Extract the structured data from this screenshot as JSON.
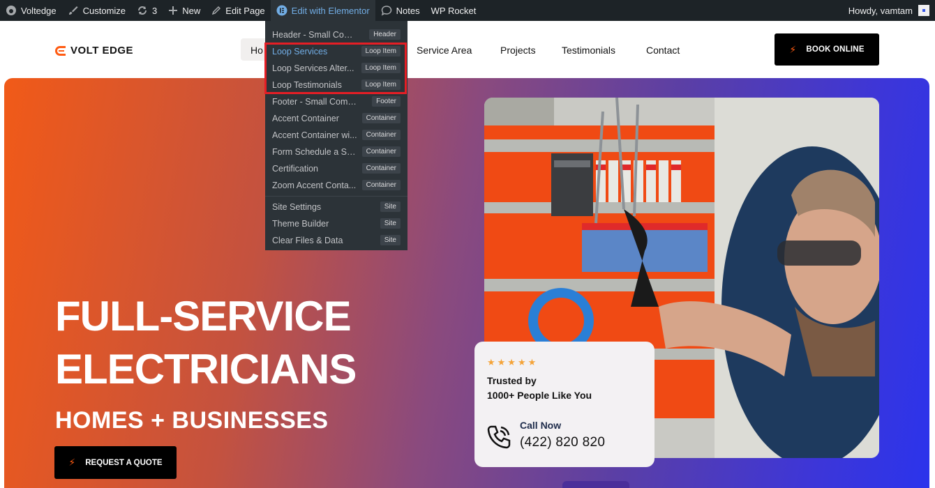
{
  "admin_bar": {
    "site_name": "Voltedge",
    "customize": "Customize",
    "updates_count": "3",
    "new": "New",
    "edit_page": "Edit Page",
    "edit_with_elementor": "Edit with Elementor",
    "notes": "Notes",
    "wp_rocket": "WP Rocket",
    "howdy": "Howdy, vamtam"
  },
  "elementor_menu": {
    "items": [
      {
        "label": "Header - Small Comp...",
        "badge": "Header"
      },
      {
        "label": "Loop Services",
        "badge": "Loop Item"
      },
      {
        "label": "Loop Services Alter...",
        "badge": "Loop Item"
      },
      {
        "label": "Loop Testimonials",
        "badge": "Loop Item"
      },
      {
        "label": "Footer - Small Company",
        "badge": "Footer"
      },
      {
        "label": "Accent Container",
        "badge": "Container"
      },
      {
        "label": "Accent Container wi...",
        "badge": "Container"
      },
      {
        "label": "Form Schedule a Se...",
        "badge": "Container"
      },
      {
        "label": "Certification",
        "badge": "Container"
      },
      {
        "label": "Zoom Accent Conta...",
        "badge": "Container"
      }
    ],
    "site_items": [
      {
        "label": "Site Settings",
        "badge": "Site"
      },
      {
        "label": "Theme Builder",
        "badge": "Site"
      },
      {
        "label": "Clear Files & Data",
        "badge": "Site"
      }
    ]
  },
  "header": {
    "logo_text": "VOLT EDGE",
    "nav_home_partial": "Ho",
    "nav": [
      "Service Area",
      "Projects",
      "Testimonials",
      "Contact"
    ],
    "book_button": "BOOK ONLINE"
  },
  "hero": {
    "title_line1": "FULL-SERVICE",
    "title_line2": "ELECTRICIANS",
    "subtitle": "HOMES + BUSINESSES",
    "quote_button": "REQUEST A QUOTE"
  },
  "trust_card": {
    "rating_stars": 5,
    "stars": "★★★★★",
    "line1": "Trusted by",
    "line2": "1000+ People Like You",
    "call_label": "Call Now",
    "phone": "(422) 820 820"
  },
  "colors": {
    "accent": "#ff5b12",
    "admin_bar": "#1d2327",
    "highlight_border": "#e51e25",
    "elementor_blue": "#72aee6"
  }
}
